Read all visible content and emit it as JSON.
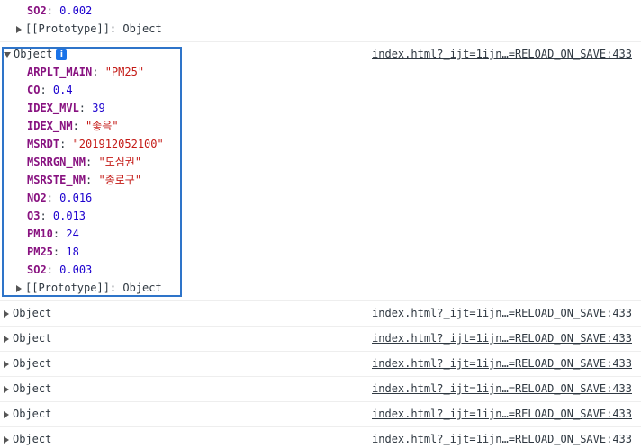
{
  "top_partial": {
    "so2_key": "SO2",
    "so2_value": "0.002",
    "prototype_label": "[[Prototype]]",
    "prototype_value": "Object"
  },
  "expanded": {
    "label": "Object",
    "info_badge": "i",
    "source": "index.html?_ijt=1ijn…=RELOAD_ON_SAVE:433",
    "props": [
      {
        "key": "ARPLT_MAIN",
        "value": "\"PM25\"",
        "kind": "str"
      },
      {
        "key": "CO",
        "value": "0.4",
        "kind": "num"
      },
      {
        "key": "IDEX_MVL",
        "value": "39",
        "kind": "num"
      },
      {
        "key": "IDEX_NM",
        "value": "\"좋음\"",
        "kind": "str"
      },
      {
        "key": "MSRDT",
        "value": "\"201912052100\"",
        "kind": "str"
      },
      {
        "key": "MSRRGN_NM",
        "value": "\"도심권\"",
        "kind": "str"
      },
      {
        "key": "MSRSTE_NM",
        "value": "\"종로구\"",
        "kind": "str"
      },
      {
        "key": "NO2",
        "value": "0.016",
        "kind": "num"
      },
      {
        "key": "O3",
        "value": "0.013",
        "kind": "num"
      },
      {
        "key": "PM10",
        "value": "24",
        "kind": "num"
      },
      {
        "key": "PM25",
        "value": "18",
        "kind": "num"
      },
      {
        "key": "SO2",
        "value": "0.003",
        "kind": "num"
      }
    ],
    "prototype_label": "[[Prototype]]",
    "prototype_value": "Object"
  },
  "collapsed": [
    {
      "label": "Object",
      "source": "index.html?_ijt=1ijn…=RELOAD_ON_SAVE:433"
    },
    {
      "label": "Object",
      "source": "index.html?_ijt=1ijn…=RELOAD_ON_SAVE:433"
    },
    {
      "label": "Object",
      "source": "index.html?_ijt=1ijn…=RELOAD_ON_SAVE:433"
    },
    {
      "label": "Object",
      "source": "index.html?_ijt=1ijn…=RELOAD_ON_SAVE:433"
    },
    {
      "label": "Object",
      "source": "index.html?_ijt=1ijn…=RELOAD_ON_SAVE:433"
    },
    {
      "label": "Object",
      "source": "index.html?_ijt=1ijn…=RELOAD_ON_SAVE:433"
    }
  ]
}
